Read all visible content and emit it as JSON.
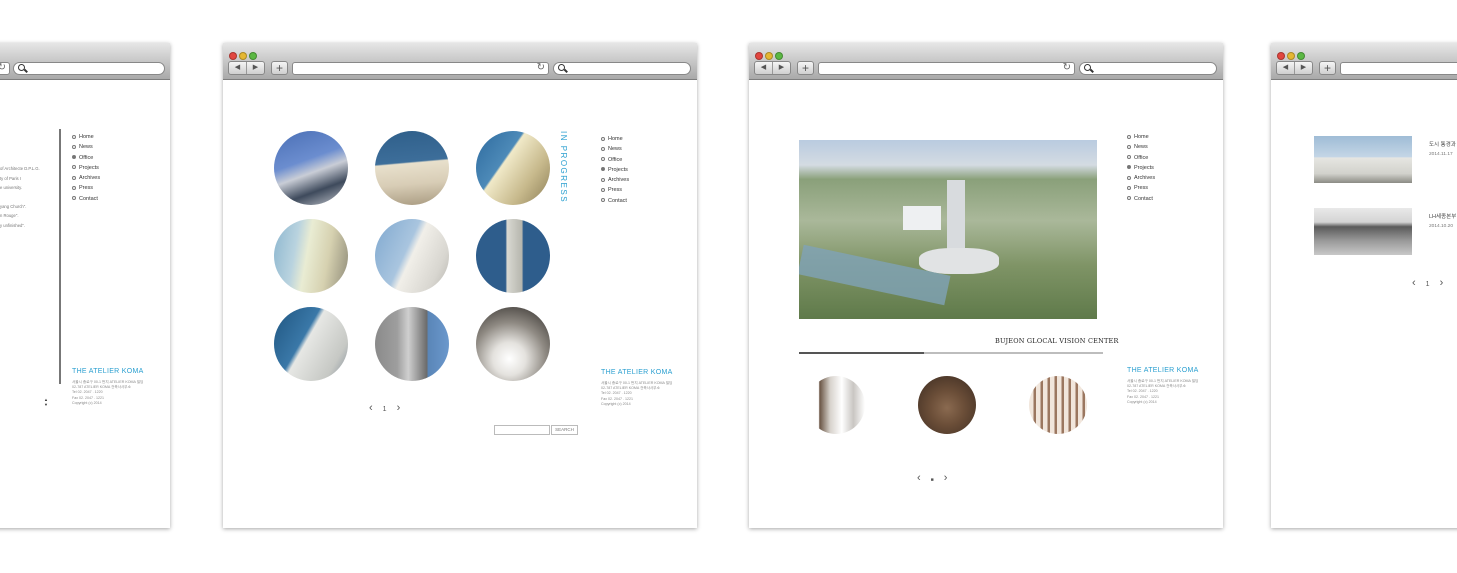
{
  "nav": [
    "Home",
    "News",
    "Office",
    "Projects",
    "Archives",
    "Press",
    "Contact"
  ],
  "brand": "THE ATELIER  KOMA",
  "address_lines": [
    "서울시 종로구 00-1 번지 ATELIER KOMA 빌딩",
    "02-787 ATELIER KOMA 건축사사무소",
    "Tel 02. 2047 . 1220",
    "Fax 02. 2047 . 1221",
    "Copyright (c) 2014"
  ],
  "window1": {
    "selected": "Office",
    "text_lines": [
      "of Architecte D.P.L.G.",
      "ty of Paris I",
      "e university.",
      "",
      "yang Church\".",
      "n Rouge\".",
      "y unfinished\"."
    ]
  },
  "window2": {
    "selected": "Projects",
    "vertical_title": "IN PROGRESS",
    "pager": {
      "prev": "‹",
      "page": "1",
      "next": "›"
    },
    "search_button": "SEARCH"
  },
  "window3": {
    "selected": "Projects",
    "project_title": "BUJEON GLOCAL VISION CENTER",
    "progress": 0.41,
    "pager": {
      "prev": "‹",
      "page": "■",
      "next": "›"
    }
  },
  "window4": {
    "items": [
      {
        "title": "도시 통경과",
        "date": "2014.11.17"
      },
      {
        "title": "LH세종본부",
        "date": "2014.10.20"
      }
    ],
    "pager": {
      "prev": "‹",
      "page": "1",
      "next": "›"
    }
  },
  "colors": {
    "accent": "#2a9fd0",
    "nav_text": "#333333"
  }
}
